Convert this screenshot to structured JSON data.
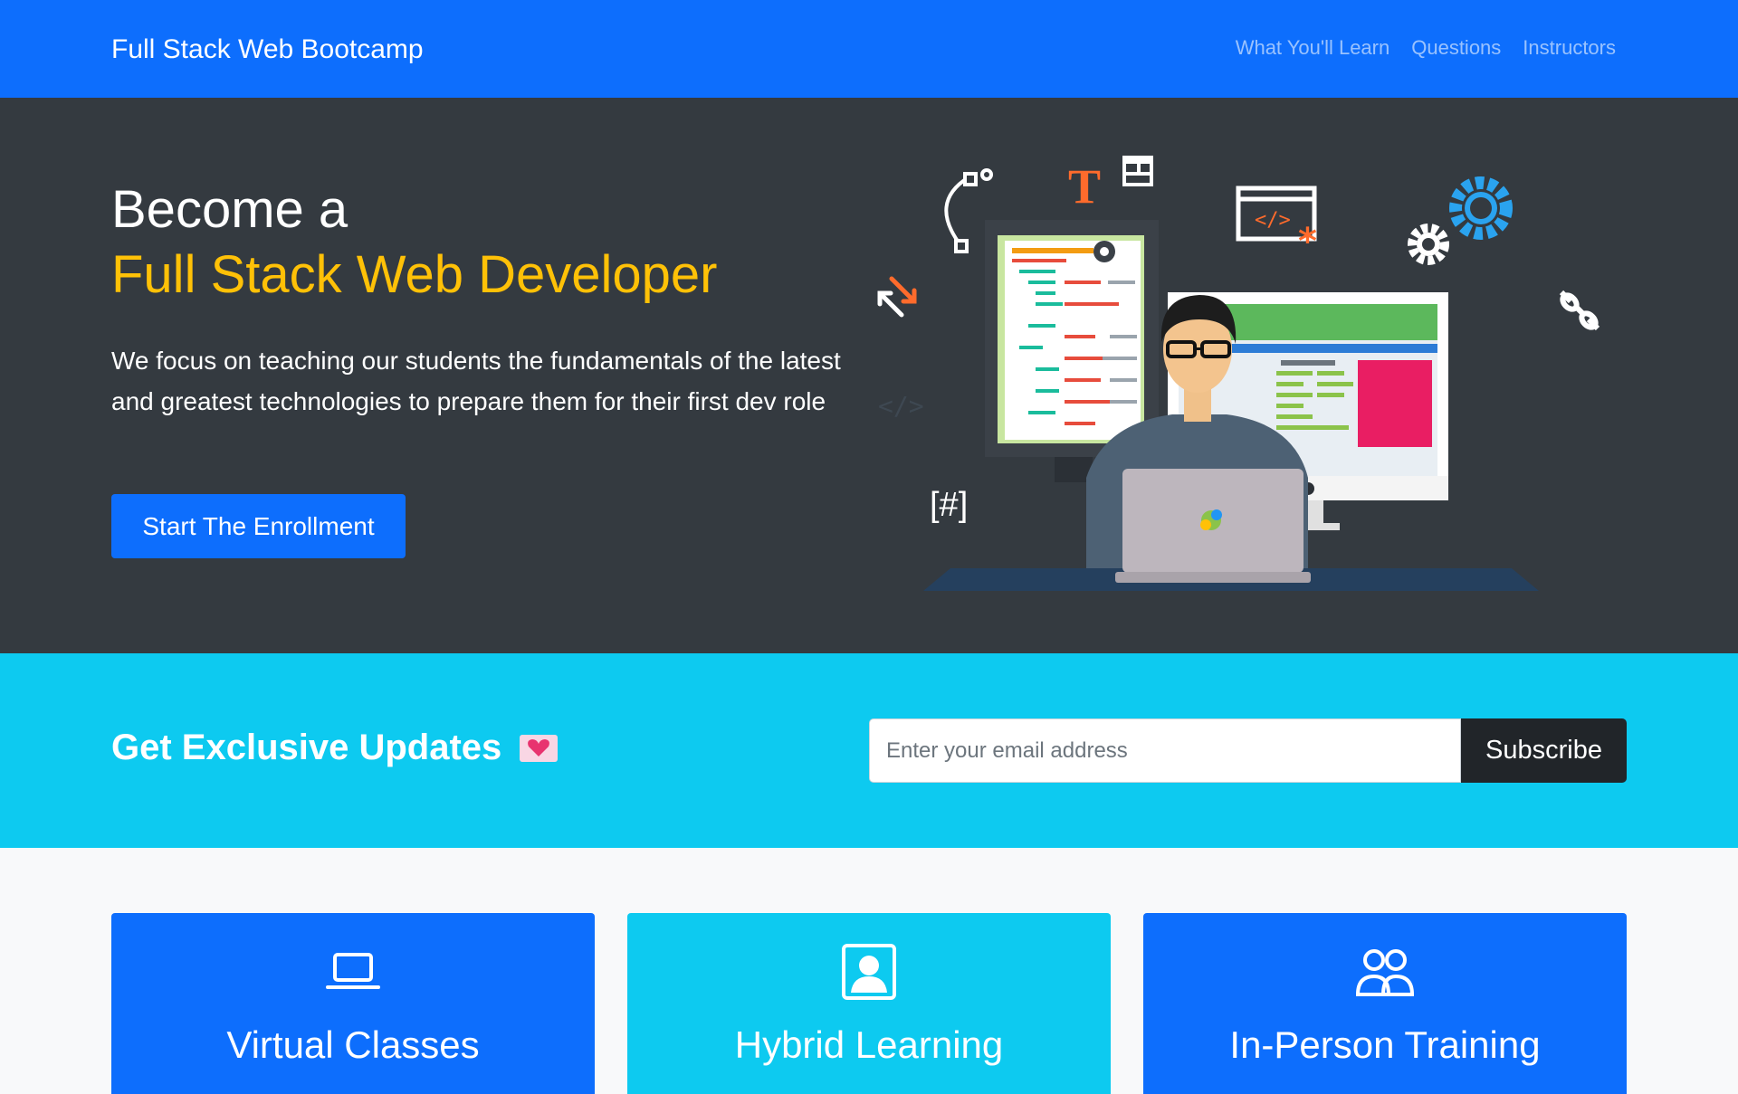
{
  "navbar": {
    "brand": "Full Stack Web Bootcamp",
    "links": [
      "What You'll Learn",
      "Questions",
      "Instructors"
    ]
  },
  "hero": {
    "title_line1": "Become a",
    "title_line2": "Full Stack Web Developer",
    "lead": "We focus on teaching our students the fundamentals of the latest and greatest technologies to prepare them for their first dev role",
    "cta_label": "Start The Enrollment",
    "illustration_text": {
      "code_tag": "</>",
      "hash_tag": "[#]",
      "font_t": "T"
    }
  },
  "newsletter": {
    "title": "Get Exclusive Updates",
    "email_placeholder": "Enter your email address",
    "subscribe_label": "Subscribe"
  },
  "cards": [
    {
      "title": "Virtual Classes",
      "icon": "laptop-icon"
    },
    {
      "title": "Hybrid Learning",
      "icon": "person-badge-icon"
    },
    {
      "title": "In-Person Training",
      "icon": "people-icon"
    }
  ],
  "colors": {
    "primary": "#0d6efd",
    "info": "#0dcaf0",
    "dark": "#343a40",
    "warning": "#ffc107"
  }
}
